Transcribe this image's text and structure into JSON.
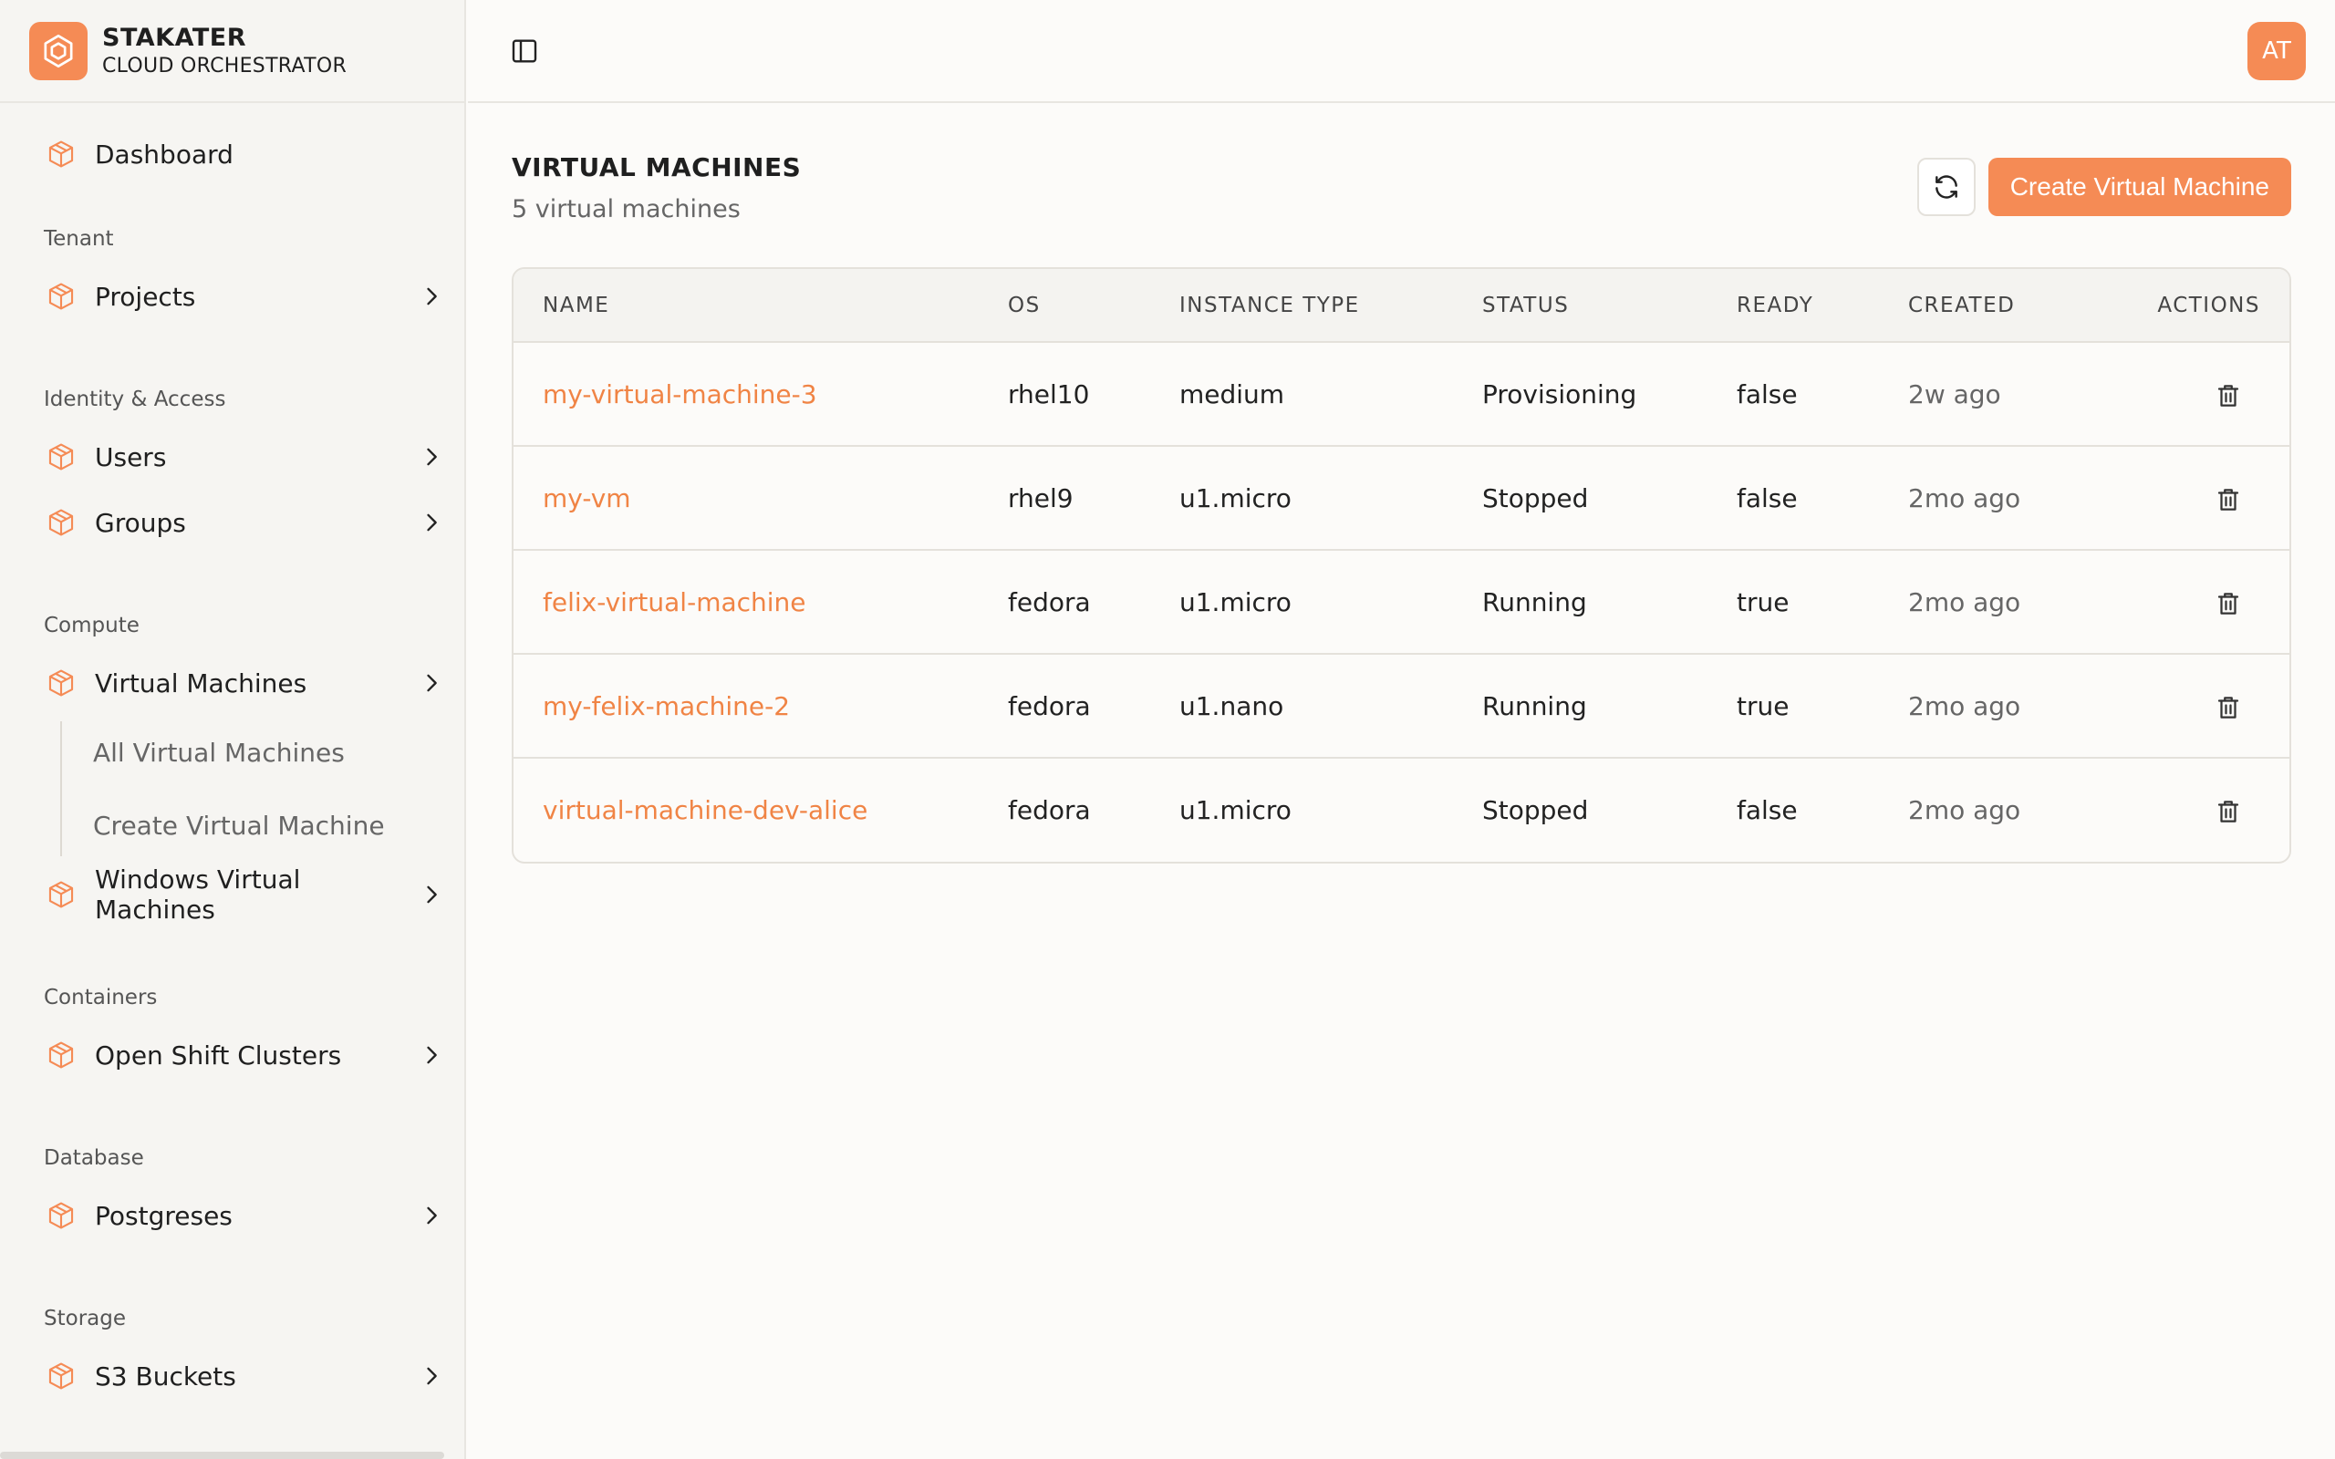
{
  "brand": {
    "name": "STAKATER",
    "subtitle": "CLOUD ORCHESTRATOR"
  },
  "user": {
    "initials": "AT"
  },
  "sidebar": {
    "dashboard": "Dashboard",
    "sections": {
      "tenant": "Tenant",
      "identity": "Identity & Access",
      "compute": "Compute",
      "containers": "Containers",
      "database": "Database",
      "storage": "Storage"
    },
    "items": {
      "projects": "Projects",
      "users": "Users",
      "groups": "Groups",
      "virtual_machines": "Virtual Machines",
      "all_vms": "All Virtual Machines",
      "create_vm": "Create Virtual Machine",
      "windows_vms": "Windows Virtual Machines",
      "openshift": "Open Shift Clusters",
      "postgreses": "Postgreses",
      "s3": "S3 Buckets"
    }
  },
  "main": {
    "title": "VIRTUAL MACHINES",
    "subtitle": "5 virtual machines",
    "create_label": "Create Virtual Machine",
    "columns": [
      "NAME",
      "OS",
      "INSTANCE TYPE",
      "STATUS",
      "READY",
      "CREATED",
      "ACTIONS"
    ],
    "rows": [
      {
        "name": "my-virtual-machine-3",
        "os": "rhel10",
        "instance": "medium",
        "status": "Provisioning",
        "ready": "false",
        "created": "2w ago"
      },
      {
        "name": "my-vm",
        "os": "rhel9",
        "instance": "u1.micro",
        "status": "Stopped",
        "ready": "false",
        "created": "2mo ago"
      },
      {
        "name": "felix-virtual-machine",
        "os": "fedora",
        "instance": "u1.micro",
        "status": "Running",
        "ready": "true",
        "created": "2mo ago"
      },
      {
        "name": "my-felix-machine-2",
        "os": "fedora",
        "instance": "u1.nano",
        "status": "Running",
        "ready": "true",
        "created": "2mo ago"
      },
      {
        "name": "virtual-machine-dev-alice",
        "os": "fedora",
        "instance": "u1.micro",
        "status": "Stopped",
        "ready": "false",
        "created": "2mo ago"
      }
    ]
  },
  "colors": {
    "accent": "#f58b55",
    "link": "#f08445"
  }
}
